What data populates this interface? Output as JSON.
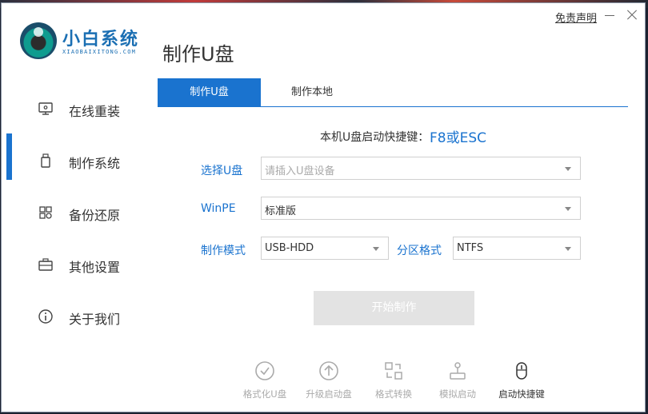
{
  "window": {
    "disclaimer": "免责声明",
    "logo_title": "小白系统",
    "logo_sub": "XIAOBAIXITONG.COM",
    "page_title": "制作U盘"
  },
  "sidebar": {
    "items": [
      {
        "label": "在线重装",
        "icon": "monitor-icon"
      },
      {
        "label": "制作系统",
        "icon": "usb-icon",
        "active": true
      },
      {
        "label": "备份还原",
        "icon": "grid-icon"
      },
      {
        "label": "其他设置",
        "icon": "briefcase-icon"
      },
      {
        "label": "关于我们",
        "icon": "info-icon"
      }
    ]
  },
  "tabs": [
    {
      "label": "制作U盘",
      "active": true
    },
    {
      "label": "制作本地"
    }
  ],
  "hotkey": {
    "label": "本机U盘启动快捷键：",
    "value": "F8或ESC"
  },
  "form": {
    "usb_label": "选择U盘",
    "usb_placeholder": "请插入U盘设备",
    "winpe_label": "WinPE",
    "winpe_value": "标准版",
    "mode_label": "制作模式",
    "mode_value": "USB-HDD",
    "partition_label": "分区格式",
    "partition_value": "NTFS"
  },
  "start_button": "开始制作",
  "tools": [
    {
      "label": "格式化U盘",
      "icon": "check-circle-icon"
    },
    {
      "label": "升级启动盘",
      "icon": "upload-circle-icon"
    },
    {
      "label": "格式转换",
      "icon": "convert-icon"
    },
    {
      "label": "模拟启动",
      "icon": "joystick-icon"
    },
    {
      "label": "启动快捷键",
      "icon": "mouse-icon"
    }
  ],
  "colors": {
    "accent": "#1a73cf",
    "disabled": "#e3e3e3"
  }
}
